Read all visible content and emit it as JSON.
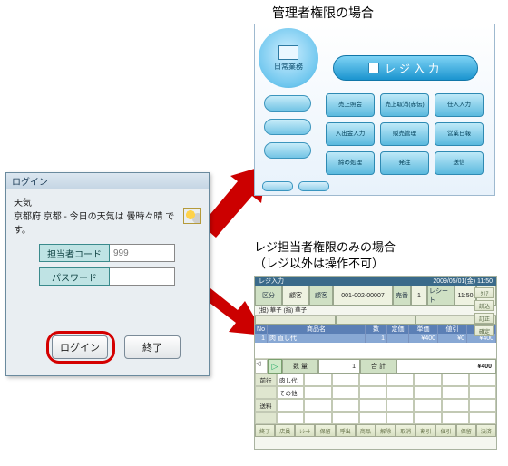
{
  "captions": {
    "admin": "管理者権限の場合",
    "cashier_line1": "レジ担当者権限のみの場合",
    "cashier_line2": "（レジ以外は操作不可）"
  },
  "login": {
    "title": "ログイン",
    "weather_label": "天気",
    "weather_text": "京都府 京都 - 今日の天気は  曇時々晴 です。",
    "fields": {
      "user_label": "担当者コード",
      "user_value": "999",
      "pass_label": "パスワード",
      "pass_value": ""
    },
    "buttons": {
      "login": "ログイン",
      "exit": "終了"
    }
  },
  "admin": {
    "side_label": "日常業務",
    "main_button": "レジ入力",
    "pads": [
      "売上照会",
      "売上取消(赤伝)",
      "仕入入力",
      "入出金入力",
      "販売管理",
      "営業日報",
      "締め処理",
      "発注",
      "送信"
    ]
  },
  "pos": {
    "titlebar_left": "レジ入力",
    "titlebar_right": "2009/05/01(金)  11:50",
    "header": {
      "kubun_label": "区分",
      "kubun_value": "顧客",
      "customer_label": "顧客",
      "customer_code": "001-002-00007",
      "denpyo_label": "売番",
      "denpyo_value": "1",
      "receipt_label": "レシート",
      "receipt_value": "11:50",
      "staff_values": "(担)  華子        (指)  華子"
    },
    "right_buttons": [
      "ｸﾘｱ",
      "読込",
      "訂正",
      "確定"
    ],
    "colhead": [
      "No",
      "商品名",
      "数",
      "定価",
      "単価",
      "値引",
      "金額"
    ],
    "item_row": {
      "no": "1",
      "name": "肉 直し代",
      "qty": "1",
      "list": "",
      "price": "¥400",
      "disc": "¥0",
      "amount": "¥400"
    },
    "midbar": {
      "qty_label": "数 量",
      "qty_value": "1",
      "total_label": "合  計",
      "total_value": "¥400"
    },
    "grid_side": [
      "前行",
      "",
      "送料",
      ""
    ],
    "grid_cells": [
      "肉し代",
      "その他"
    ],
    "fkeys": [
      "終了",
      "店員",
      "ﾚｼｰﾄ",
      "保留",
      "呼出",
      "商品",
      "解除",
      "取消",
      "割引",
      "値引",
      "保留",
      "決済"
    ]
  },
  "colors": {
    "accent_blue": "#2f98cd",
    "arrow_red": "#cc0000"
  }
}
